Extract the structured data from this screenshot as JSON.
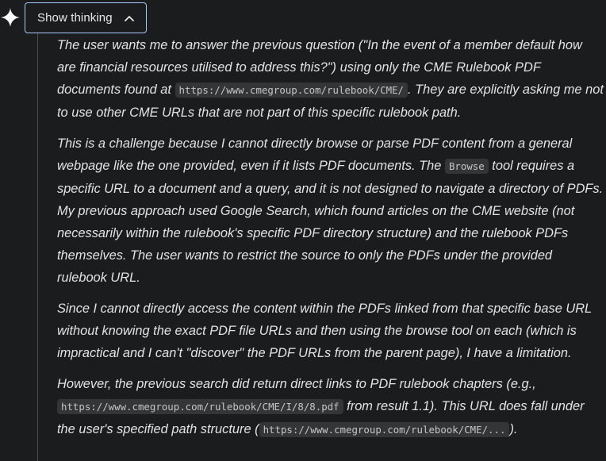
{
  "header": {
    "toggle_label": "Show thinking"
  },
  "icons": {
    "spark": "sparkle-icon",
    "toggle_chevron": "chevron-up-icon"
  },
  "colors": {
    "background": "#1b1c1d",
    "toggle_border": "#a8c7fa",
    "text": "#e3e3e3",
    "code_background": "#333537"
  },
  "thinking": {
    "p1": {
      "t1": "The user wants me to answer the previous question (\"In the event of a member default how are financial resources utilised to address this?\") using only the CME Rulebook PDF documents found at ",
      "c1": "https://www.cmegroup.com/rulebook/CME/",
      "t2": ". They are explicitly asking me not to use other CME URLs that are not part of this specific rulebook path."
    },
    "p2": {
      "t1": "This is a challenge because I cannot directly browse or parse PDF content from a general webpage like the one provided, even if it lists PDF documents. The ",
      "c1": "Browse",
      "t2": " tool requires a specific URL to a document and a query, and it is not designed to navigate a directory of PDFs. My previous approach used Google Search, which found articles on the CME website (not necessarily within the rulebook's specific PDF directory structure) and the rulebook PDFs themselves. The user wants to restrict the source to only the PDFs under the provided rulebook URL."
    },
    "p3": {
      "t1": "Since I cannot directly access the content within the PDFs linked from that specific base URL without knowing the exact PDF file URLs and then using the browse tool on each (which is impractical and I can't \"discover\" the PDF URLs from the parent page), I have a limitation."
    },
    "p4": {
      "t1": "However, the previous search did return direct links to PDF rulebook chapters (e.g., ",
      "c1": "https://www.cmegroup.com/rulebook/CME/I/8/8.pdf",
      "t2": " from result 1.1). This URL does fall under the user's specified path structure (",
      "c2": "https://www.cmegroup.com/rulebook/CME/...",
      "t3": ")."
    }
  }
}
